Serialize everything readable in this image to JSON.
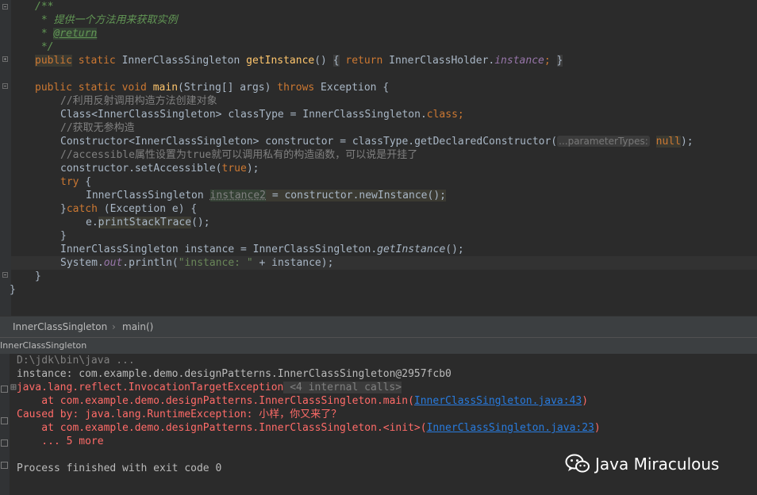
{
  "editor": {
    "lines": {
      "l1": "/**",
      "l2": " * 提供一个方法用来获取实例",
      "l3a": " * ",
      "l3b": "@return",
      "l4": " */",
      "l5_public": "public",
      "l5_static": " static ",
      "l5_type": "InnerClassSingleton ",
      "l5_fn": "getInstance",
      "l5_paren": "() ",
      "l5_ob": "{",
      "l5_ret": " return ",
      "l5_holder": "InnerClassHolder.",
      "l5_inst": "instance",
      "l5_semi": "; ",
      "l5_cb": "}",
      "l7_kw": "public static void ",
      "l7_fn": "main",
      "l7_args": "(String[] args) ",
      "l7_throws": "throws",
      "l7_exc": " Exception {",
      "l8": "//利用反射调用构造方法创建对象",
      "l9a": "Class<InnerClassSingleton> classType = InnerClassSingleton.",
      "l9b": "class",
      "l9c": ";",
      "l10": "//获取无参构造",
      "l11a": "Constructor<InnerClassSingleton> constructor = classType.getDeclaredConstructor(",
      "l11hint": "...parameterTypes:",
      "l11null": "null",
      "l11b": ");",
      "l12": "//accessible属性设置为true就可以调用私有的构造函数，可以说是开挂了",
      "l13a": "constructor.setAccessible(",
      "l13b": "true",
      "l13c": ");",
      "l14a": "try",
      "l14b": " {",
      "l15a": "InnerClassSingleton ",
      "l15b": "instance2",
      "l15c": " = constructor.newInstance();",
      "l16a": "}",
      "l16b": "catch",
      "l16c": " (Exception e) {",
      "l17a": "e.",
      "l17b": "printStackTrace",
      "l17c": "();",
      "l18": "}",
      "l19a": "InnerClassSingleton instance = InnerClassSingleton.",
      "l19b": "getInstance",
      "l19c": "();",
      "l20a": "System.",
      "l20b": "out",
      "l20c": ".println(",
      "l20d": "\"instance: \"",
      "l20e": " + instance);",
      "l21": "}",
      "l22": "}"
    }
  },
  "breadcrumb": {
    "class": "InnerClassSingleton",
    "sep": "›",
    "method": "main()"
  },
  "run": {
    "title": "InnerClassSingleton"
  },
  "console": {
    "c1": "D:\\jdk\\bin\\java ...",
    "c2": "instance: com.example.demo.designPatterns.InnerClassSingleton@2957fcb0",
    "c3a": "java.lang.reflect.InvocationTargetException",
    "c3b": " <4 internal calls>",
    "c4a": "    at com.example.demo.designPatterns.InnerClassSingleton.main(",
    "c4link": "InnerClassSingleton.java:43",
    "c4b": ")",
    "c5": "Caused by: java.lang.RuntimeException: 小样，你又来了？",
    "c6a": "    at com.example.demo.designPatterns.InnerClassSingleton.<init>(",
    "c6link": "InnerClassSingleton.java:23",
    "c6b": ")",
    "c7": "    ... 5 more",
    "c8": "Process finished with exit code 0"
  },
  "watermark": {
    "text": "Java Miraculous",
    "icon": "wechat-icon"
  }
}
